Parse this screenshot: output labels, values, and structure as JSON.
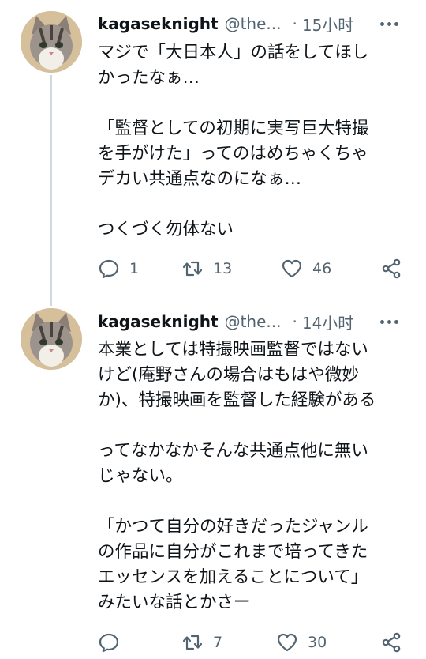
{
  "tweets": [
    {
      "display_name": "kagaseknight",
      "handle": "@the...",
      "separator": "·",
      "time": "15小时",
      "lines": [
        "マジで「大日本人」の話をしてほし",
        "かったなぁ…",
        "",
        "「監督としての初期に実写巨大特撮",
        "を手がけた」ってのはめちゃくちゃ",
        "デカい共通点なのになぁ…",
        "",
        "つくづく勿体ない"
      ],
      "reply_count": "1",
      "retweet_count": "13",
      "like_count": "46"
    },
    {
      "display_name": "kagaseknight",
      "handle": "@the...",
      "separator": "·",
      "time": "14小时",
      "lines": [
        "本業としては特撮映画監督ではない",
        "けど(庵野さんの場合はもはや微妙",
        "か)、特撮映画を監督した経験がある",
        "",
        "ってなかなかそんな共通点他に無い",
        "じゃない。",
        "",
        "「かつて自分の好きだったジャンル",
        "の作品に自分がこれまで培ってきた",
        "エッセンスを加えることについて」",
        "みたいな話とかさー"
      ],
      "reply_count": "",
      "retweet_count": "7",
      "like_count": "30"
    }
  ],
  "icons": {
    "reply": "reply-icon",
    "retweet": "retweet-icon",
    "like": "heart-icon",
    "share": "share-icon",
    "more": "more-icon"
  },
  "colors": {
    "text": "#0f1419",
    "secondary": "#536471",
    "thread_line": "#cfd9de"
  }
}
